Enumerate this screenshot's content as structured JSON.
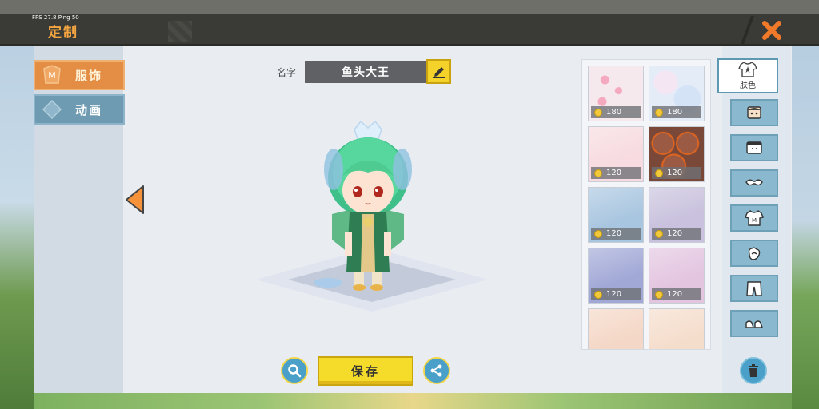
{
  "status": {
    "fps": "FPS 27.8  Ping 50"
  },
  "header": {
    "title": "定制"
  },
  "tabs": [
    {
      "label": "服饰",
      "active": true
    },
    {
      "label": "动画",
      "active": false
    }
  ],
  "name": {
    "label": "名字",
    "value": "鱼头大王"
  },
  "actions": {
    "save_label": "保存"
  },
  "skins": [
    {
      "price": "180",
      "color": "#f6e9ee",
      "pattern": "flowers"
    },
    {
      "price": "180",
      "color": "#e4ecf8",
      "pattern": "clouds"
    },
    {
      "price": "120",
      "color": "#f7dbe0",
      "pattern": "none"
    },
    {
      "price": "120",
      "color": "#7a4838",
      "pattern": "lava"
    },
    {
      "price": "120",
      "color": "#a9c6e0",
      "pattern": "none"
    },
    {
      "price": "120",
      "color": "#c9c1dd",
      "pattern": "none"
    },
    {
      "price": "120",
      "color": "#a1a8d6",
      "pattern": "none"
    },
    {
      "price": "120",
      "color": "#e3c5e0",
      "pattern": "none"
    },
    {
      "price": "",
      "color": "#f4d7c6",
      "pattern": "none"
    },
    {
      "price": "",
      "color": "#f5ddcc",
      "pattern": "none"
    }
  ],
  "categories": {
    "active_label": "肤色",
    "items": [
      "face-icon",
      "hair-icon",
      "mask-icon",
      "shirt-icon",
      "glove-icon",
      "pants-icon",
      "shoes-icon"
    ]
  },
  "colors": {
    "accent": "#e38d45",
    "save": "#f5dc2a",
    "tab_inactive": "#6f9bb2"
  }
}
